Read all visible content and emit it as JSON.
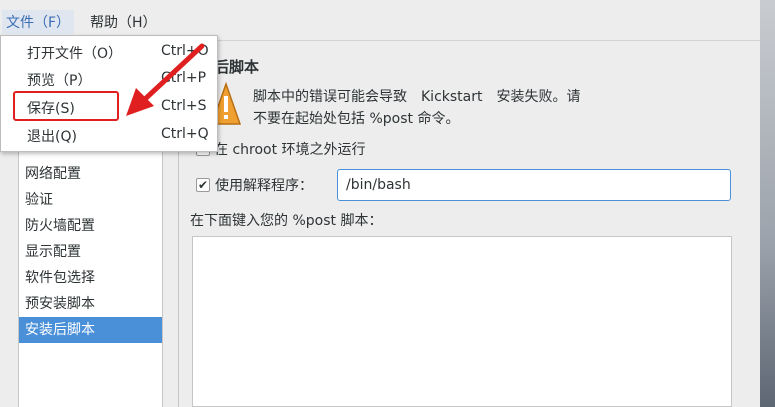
{
  "menubar": {
    "file": "文件（F）",
    "help": "帮助（H）"
  },
  "file_menu": {
    "items": [
      {
        "label": "打开文件（O）",
        "accel": "Ctrl+O"
      },
      {
        "label": "预览（P）",
        "accel": "Ctrl+P"
      },
      {
        "label": "保存(S)",
        "accel": "Ctrl+S"
      },
      {
        "label": "退出(Q)",
        "accel": "Ctrl+Q"
      }
    ],
    "highlighted_item": "保存(S)",
    "highlight_color": "#e02020"
  },
  "sidebar": {
    "items": [
      {
        "label": "网络配置"
      },
      {
        "label": "验证"
      },
      {
        "label": "防火墙配置"
      },
      {
        "label": "显示配置"
      },
      {
        "label": "软件包选择"
      },
      {
        "label": "预安装脚本"
      },
      {
        "label": "安装后脚本",
        "selected": true
      }
    ],
    "selected_color": "#4a90d9"
  },
  "content": {
    "section_title": "后脚本",
    "warning_line1": "脚本中的错误可能会导致　Kickstart　安装失败。请",
    "warning_line2": "不要在起始处包括 %post 命令。",
    "chroot_label": "在 chroot 环境之外运行",
    "chroot_checked": false,
    "interpreter_label": "使用解释程序：",
    "interpreter_checked": true,
    "interpreter_value": "/bin/bash",
    "script_label": "在下面键入您的 %post 脚本：",
    "script_value": ""
  },
  "icons": {
    "warning": "warning-icon",
    "checkmark": "✔"
  }
}
